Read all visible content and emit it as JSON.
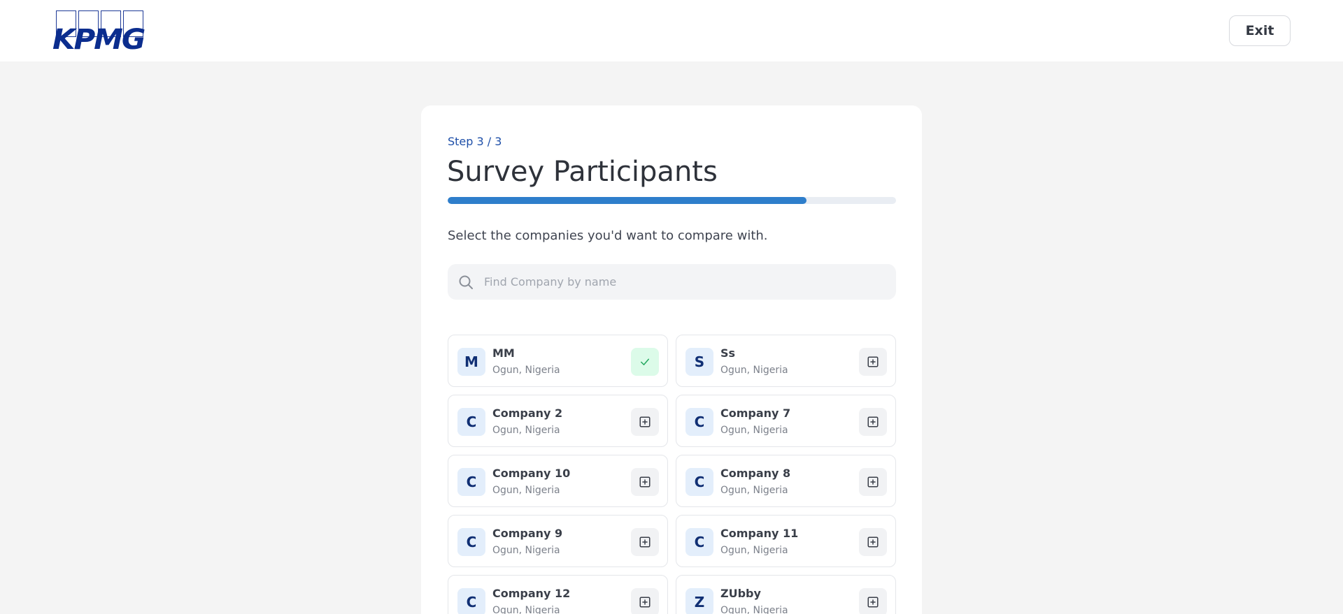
{
  "header": {
    "logo_text": "KPMG",
    "exit_label": "Exit"
  },
  "survey": {
    "step_label": "Step 3 / 3",
    "title": "Survey Participants",
    "progress_percent": 80,
    "subtitle": "Select the companies you'd want to compare with.",
    "search_placeholder": "Find Company by name"
  },
  "companies": [
    {
      "initial": "M",
      "name": "MM",
      "location": "Ogun, Nigeria",
      "selected": true
    },
    {
      "initial": "S",
      "name": "Ss",
      "location": "Ogun, Nigeria",
      "selected": false
    },
    {
      "initial": "C",
      "name": "Company 2",
      "location": "Ogun, Nigeria",
      "selected": false
    },
    {
      "initial": "C",
      "name": "Company 7",
      "location": "Ogun, Nigeria",
      "selected": false
    },
    {
      "initial": "C",
      "name": "Company 10",
      "location": "Ogun, Nigeria",
      "selected": false
    },
    {
      "initial": "C",
      "name": "Company 8",
      "location": "Ogun, Nigeria",
      "selected": false
    },
    {
      "initial": "C",
      "name": "Company 9",
      "location": "Ogun, Nigeria",
      "selected": false
    },
    {
      "initial": "C",
      "name": "Company 11",
      "location": "Ogun, Nigeria",
      "selected": false
    },
    {
      "initial": "C",
      "name": "Company 12",
      "location": "Ogun, Nigeria",
      "selected": false
    },
    {
      "initial": "Z",
      "name": "ZUbby",
      "location": "Ogun, Nigeria",
      "selected": false
    }
  ],
  "icons": {
    "selected_icon": "check-icon",
    "unselected_icon": "plus-square-icon",
    "search_icon": "search-icon"
  },
  "colors": {
    "brand": "#0b2d8e",
    "progress": "#2e7ecb",
    "selected_bg": "#dcfbe9",
    "check": "#23a85f"
  }
}
